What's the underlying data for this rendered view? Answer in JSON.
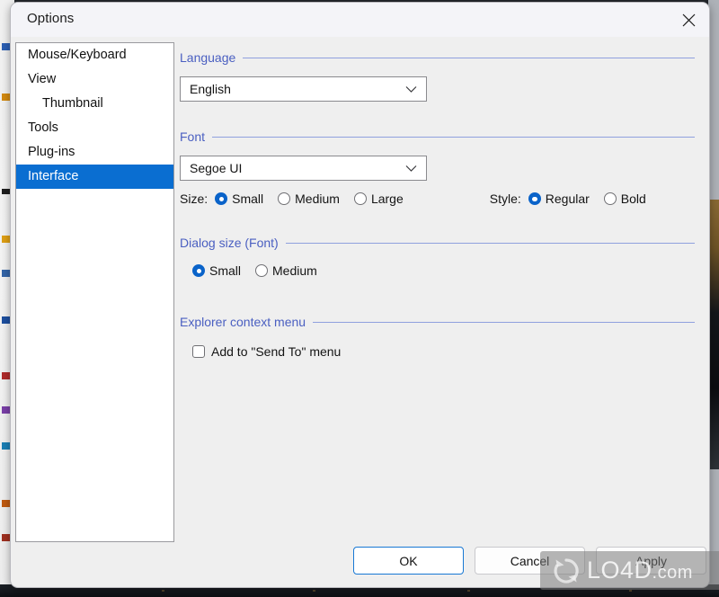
{
  "window": {
    "title": "Options",
    "close_icon": "close-icon"
  },
  "sidebar": {
    "items": [
      {
        "label": "Mouse/Keyboard",
        "indent": false,
        "selected": false
      },
      {
        "label": "View",
        "indent": false,
        "selected": false
      },
      {
        "label": "Thumbnail",
        "indent": true,
        "selected": false
      },
      {
        "label": "Tools",
        "indent": false,
        "selected": false
      },
      {
        "label": "Plug-ins",
        "indent": false,
        "selected": false
      },
      {
        "label": "Interface",
        "indent": false,
        "selected": true
      }
    ]
  },
  "groups": {
    "language": {
      "title": "Language",
      "combo_value": "English",
      "combo_icon": "chevron-down-icon"
    },
    "font": {
      "title": "Font",
      "combo_value": "Segoe UI",
      "combo_icon": "chevron-down-icon",
      "size_label": "Size:",
      "size_options": [
        {
          "label": "Small",
          "selected": true
        },
        {
          "label": "Medium",
          "selected": false
        },
        {
          "label": "Large",
          "selected": false
        }
      ],
      "style_label": "Style:",
      "style_options": [
        {
          "label": "Regular",
          "selected": true
        },
        {
          "label": "Bold",
          "selected": false
        }
      ]
    },
    "dialog_size": {
      "title": "Dialog size (Font)",
      "options": [
        {
          "label": "Small",
          "selected": true
        },
        {
          "label": "Medium",
          "selected": false
        }
      ]
    },
    "explorer_context_menu": {
      "title": "Explorer context menu",
      "checkbox_label": "Add to \"Send To\" menu",
      "checkbox_checked": false
    }
  },
  "footer": {
    "ok_label": "OK",
    "cancel_label": "Cancel",
    "apply_label": "Apply"
  },
  "watermark": {
    "text": "LO4D",
    "suffix": ".com"
  },
  "colors": {
    "accent_blue": "#0a6ed1",
    "group_title_blue": "#4a5fc1",
    "group_rule_blue": "#8fa0de",
    "radio_blue": "#0a63c9",
    "default_button_border": "#1878d4",
    "dialog_bg": "#efefef",
    "titlebar_bg": "#f4f4f8"
  }
}
